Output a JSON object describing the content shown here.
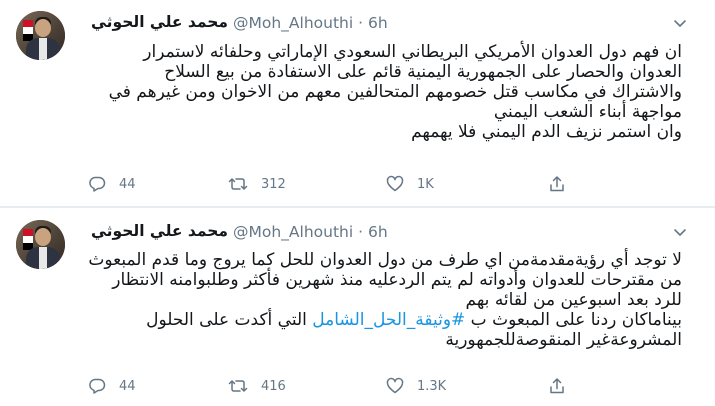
{
  "tweets": [
    {
      "display_name": "محمد علي الحوثي",
      "handle": "@Moh_Alhouthi",
      "separator": "·",
      "time": "6h",
      "lines": [
        "ان فهم دول العدوان الأمريكي البريطاني السعودي الإماراتي وحلفائه لاستمرار",
        "العدوان والحصار على الجمهورية اليمنية قائم على الاستفادة من بيع السلاح",
        "والاشتراك في مكاسب قتل خصومهم المتحالفين معهم من الاخوان ومن غيرهم في",
        "مواجهة أبناء الشعب اليمني",
        "وان استمر نزيف الدم اليمني فلا يهمهم"
      ],
      "replies": "44",
      "retweets": "312",
      "likes": "1K"
    },
    {
      "display_name": "محمد علي الحوثي",
      "handle": "@Moh_Alhouthi",
      "separator": "·",
      "time": "6h",
      "lines": [
        "لا توجد أي رؤيةمقدمةمن اي طرف من دول العدوان للحل كما يروج وما قدم المبعوث",
        "من مقترحات للعدوان وأدواته لم يتم الردعليه منذ شهرين فأكثر وطلبوامنه الانتظار",
        "للرد بعد اسبوعين من لقائه بهم"
      ],
      "line4_before": "بيناماكان ردنا على المبعوث ب ",
      "hashtag": "#وثيقة_الحل_الشامل",
      "line4_after": " التي أكدت على الحلول",
      "line5": "المشروعةغير المنقوصةللجمهورية",
      "replies": "44",
      "retweets": "416",
      "likes": "1.3K"
    }
  ],
  "colors": {
    "text": "#14171a",
    "muted": "#657786",
    "link": "#1b95e0",
    "border": "#e6ecf0"
  },
  "icons": [
    "reply-icon",
    "retweet-icon",
    "like-icon",
    "share-icon",
    "chevron-down-icon"
  ]
}
